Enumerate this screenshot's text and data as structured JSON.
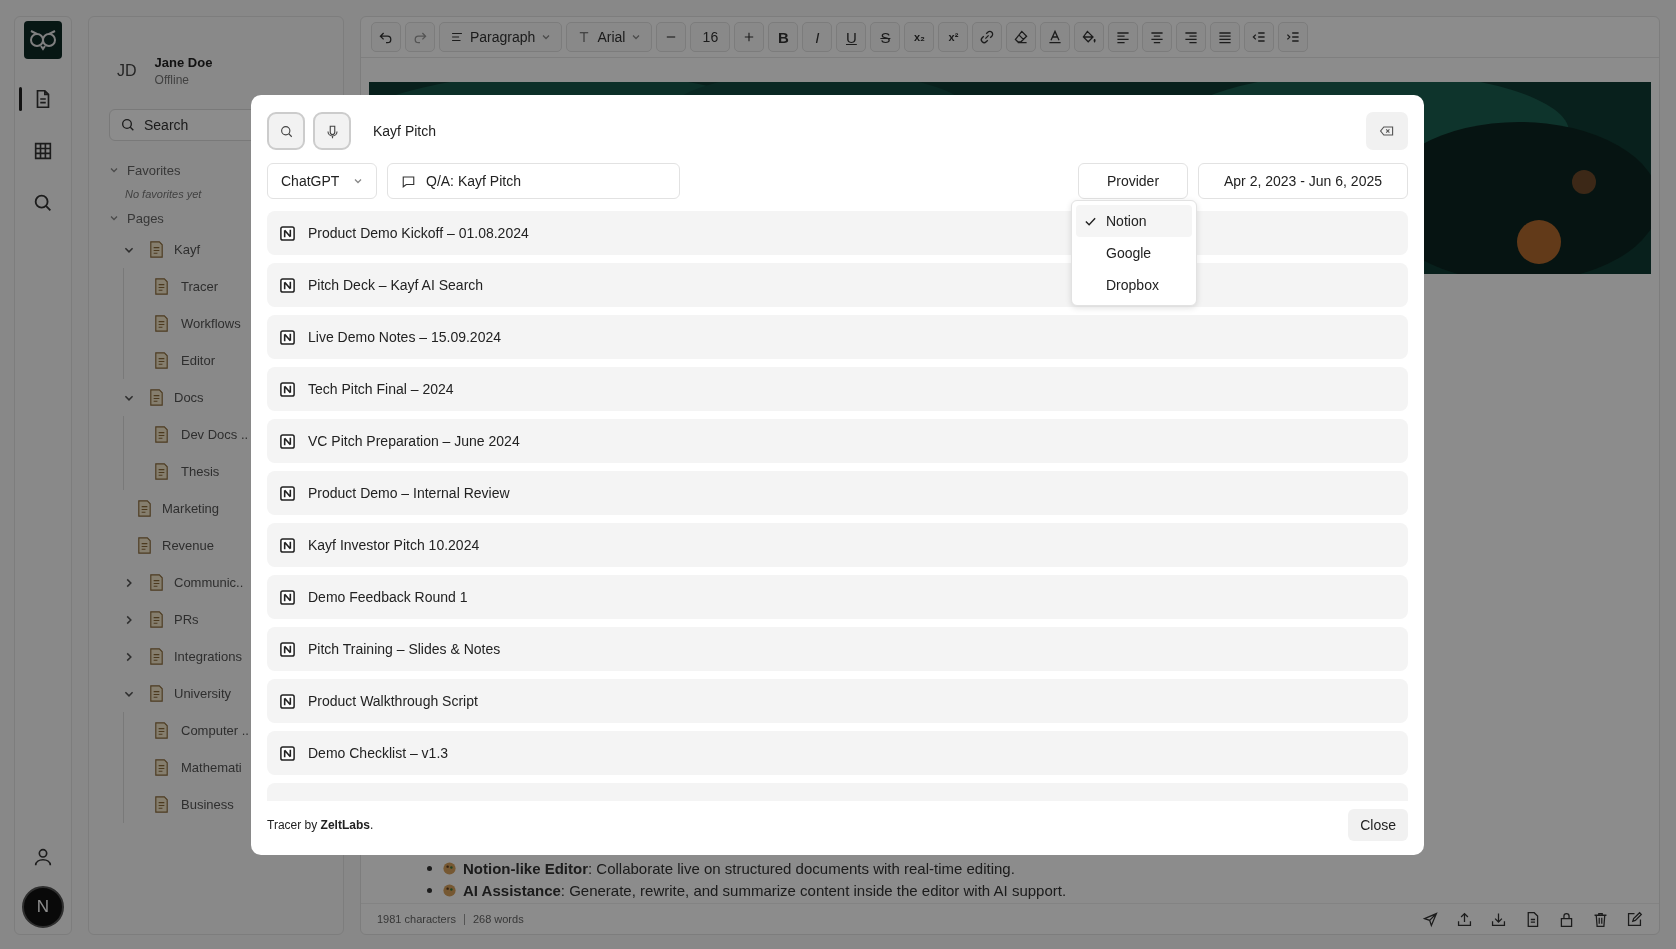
{
  "rail": {
    "avatar": "N"
  },
  "sidebar": {
    "user": {
      "initials": "JD",
      "name": "Jane Doe",
      "status": "Offline"
    },
    "search": {
      "placeholder": "Search"
    },
    "sections": [
      {
        "label": "Favorites",
        "expanded": true,
        "note": "No favorites yet"
      },
      {
        "label": "Pages",
        "expanded": true,
        "children": [
          {
            "label": "Kayf",
            "expanded": true,
            "children": [
              {
                "label": "Tracer"
              },
              {
                "label": "Workflows"
              },
              {
                "label": "Editor"
              }
            ]
          },
          {
            "label": "Docs",
            "expanded": true,
            "children": [
              {
                "label": "Dev Docs .."
              },
              {
                "label": "Thesis"
              }
            ]
          },
          {
            "label": "Marketing"
          },
          {
            "label": "Revenue"
          },
          {
            "label": "Communic..",
            "expanded": false
          },
          {
            "label": "PRs",
            "expanded": false
          },
          {
            "label": "Integrations",
            "expanded": false
          },
          {
            "label": "University",
            "expanded": true,
            "children": [
              {
                "label": "Computer .."
              },
              {
                "label": "Mathemati"
              },
              {
                "label": "Business"
              }
            ]
          }
        ]
      }
    ]
  },
  "toolbar": {
    "block_style": "Paragraph",
    "font": "Arial",
    "font_size": "16",
    "format_keys": [
      "B",
      "I",
      "U",
      "S",
      "x₂",
      "x²"
    ]
  },
  "editor": {
    "bullets": [
      "**Notion-like Editor**: Collaborate live on structured documents with real-time editing.",
      "**AI Assistance**: Generate, rewrite, and summarize content inside the editor with AI support."
    ],
    "status": {
      "characters": "1981 characters",
      "words": "268 words"
    }
  },
  "dialog": {
    "query": "Kayf Pitch",
    "model": "ChatGPT",
    "qa": "Q/A: Kayf Pitch",
    "provider_button": "Provider",
    "date_range": "Apr 2, 2023 - Jun 6, 2025",
    "provider_menu": [
      {
        "label": "Notion",
        "selected": true
      },
      {
        "label": "Google",
        "selected": false
      },
      {
        "label": "Dropbox",
        "selected": false
      }
    ],
    "results": [
      "Product Demo Kickoff – 01.08.2024",
      "Pitch Deck – Kayf AI Search",
      "Live Demo Notes – 15.09.2024",
      "Tech Pitch Final – 2024",
      "VC Pitch Preparation – June 2024",
      "Product Demo – Internal Review",
      "Kayf Investor Pitch 10.2024",
      "Demo Feedback Round 1",
      "Pitch Training – Slides & Notes",
      "Product Walkthrough Script",
      "Demo Checklist – v1.3"
    ],
    "footer": "Tracer by **ZeltLabs**.",
    "close": "Close"
  }
}
